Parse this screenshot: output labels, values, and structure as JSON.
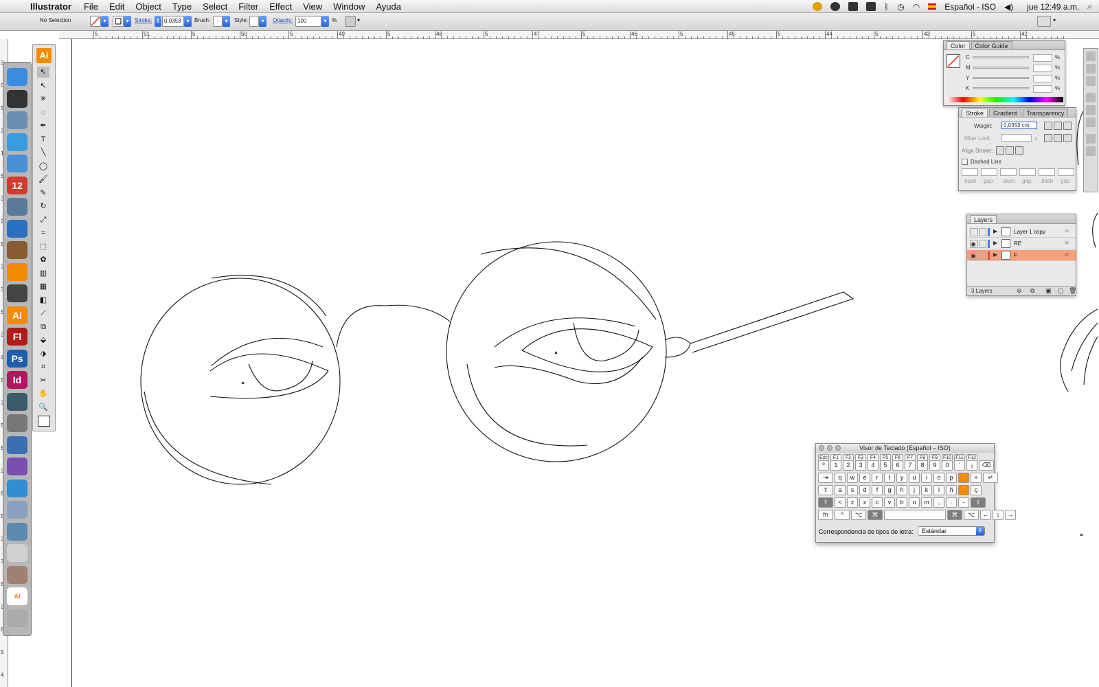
{
  "menubar": {
    "app_name": "Illustrator",
    "items": [
      "File",
      "Edit",
      "Object",
      "Type",
      "Select",
      "Filter",
      "Effect",
      "View",
      "Window",
      "Ayuda"
    ],
    "input_source": "Español - ISO",
    "clock": "jue 12:49 a.m.",
    "status_icons": [
      "moon-icon",
      "dictation-icon",
      "spaces-icon",
      "display-icon",
      "bluetooth-icon",
      "time-machine-icon",
      "wifi-icon",
      "flag-icon",
      "volume-icon",
      "spotlight-icon"
    ]
  },
  "control": {
    "selection": "No Selection",
    "stroke_label": "Stroke:",
    "stroke_value": "0,0353",
    "brush_label": "Brush:",
    "brush_value": "-",
    "style_label": "Style:",
    "opacity_label": "Opacity:",
    "opacity_value": "100",
    "percent": "%"
  },
  "ruler": {
    "h_labels": [
      "5",
      "51",
      "5",
      "50",
      "5",
      "49",
      "5",
      "48",
      "5",
      "47",
      "5",
      "46",
      "5",
      "45",
      "5",
      "44",
      "5",
      "43",
      "5",
      "42"
    ],
    "v_labels": [
      "3",
      "0",
      "5",
      "3",
      "1",
      "5",
      "3",
      "2",
      "5",
      "3",
      "3",
      "5",
      "3",
      "4",
      "5",
      "3",
      "5",
      "5",
      "3",
      "6",
      "5",
      "3",
      "7",
      "5",
      "3",
      "8",
      "5",
      "4"
    ]
  },
  "dock": {
    "items": [
      {
        "name": "finder",
        "label": "",
        "color": "#3b8be0"
      },
      {
        "name": "dashboard",
        "label": "",
        "color": "#333333"
      },
      {
        "name": "mail",
        "label": "",
        "color": "#6a8fb0"
      },
      {
        "name": "ichat",
        "label": "",
        "color": "#3b9be0"
      },
      {
        "name": "safari",
        "label": "",
        "color": "#4a90d9"
      },
      {
        "name": "ical",
        "label": "12",
        "color": "#d33a2f"
      },
      {
        "name": "iphoto",
        "label": "",
        "color": "#5a7a9a"
      },
      {
        "name": "itunes",
        "label": "",
        "color": "#2b6fc0"
      },
      {
        "name": "photo-booth",
        "label": "",
        "color": "#8a5a30"
      },
      {
        "name": "vlc",
        "label": "",
        "color": "#f28b00"
      },
      {
        "name": "imovie",
        "label": "",
        "color": "#444444"
      },
      {
        "name": "illustrator",
        "label": "Ai",
        "color": "#f28b00"
      },
      {
        "name": "flash",
        "label": "Fl",
        "color": "#b01c1c"
      },
      {
        "name": "photoshop",
        "label": "Ps",
        "color": "#1c5fb0"
      },
      {
        "name": "indesign",
        "label": "Id",
        "color": "#b0175e"
      },
      {
        "name": "time-machine",
        "label": "",
        "color": "#3b5a6a"
      },
      {
        "name": "system-preferences",
        "label": "",
        "color": "#777777"
      },
      {
        "name": "word",
        "label": "",
        "color": "#3b6fb0"
      },
      {
        "name": "entourage",
        "label": "",
        "color": "#7a4fb0"
      },
      {
        "name": "messenger",
        "label": "",
        "color": "#2f8fd0"
      },
      {
        "name": "applications-folder",
        "label": "",
        "color": "#8aa0c0"
      },
      {
        "name": "preview",
        "label": "",
        "color": "#5a8ab0"
      },
      {
        "name": "document-stack",
        "label": "",
        "color": "#d0d0d0"
      },
      {
        "name": "pictures-stack",
        "label": "",
        "color": "#a08070"
      },
      {
        "name": "ai-file",
        "label": "AI",
        "color": "#ffffff"
      },
      {
        "name": "trash",
        "label": "",
        "color": "#aaaaaa"
      }
    ]
  },
  "tools": {
    "header": "Ai",
    "items": [
      "selection",
      "direct-selection",
      "magic-wand",
      "lasso",
      "pen",
      "type",
      "line",
      "ellipse",
      "paintbrush",
      "pencil",
      "rotate",
      "scale",
      "warp",
      "free-transform",
      "symbol-sprayer",
      "column-graph",
      "mesh",
      "gradient",
      "eyedropper",
      "blend",
      "live-paint-bucket",
      "live-paint-selection",
      "crop",
      "scissors",
      "hand",
      "zoom"
    ],
    "glyphs": [
      "↖",
      "↖",
      "✳",
      "◌",
      "✒",
      "T",
      "╲",
      "◯",
      "🖌",
      "✎",
      "↻",
      "⤢",
      "≈",
      "⬚",
      "✿",
      "▥",
      "▦",
      "◧",
      "⟋",
      "⧉",
      "⬙",
      "⬗",
      "⌗",
      "✂",
      "✋",
      "🔍"
    ]
  },
  "color_panel": {
    "tabs": [
      "Color",
      "Color Guide"
    ],
    "channels": [
      "C",
      "M",
      "Y",
      "K"
    ],
    "percent": "%"
  },
  "stroke_panel": {
    "tabs": [
      "Stroke",
      "Gradient",
      "Transparency"
    ],
    "weight_label": "Weight:",
    "weight_value": "0,0353 cm",
    "miter_label": "Miter Limit:",
    "miter_x": "x",
    "align_label": "Align Stroke:",
    "dashed_label": "Dashed Line",
    "dash_labels": [
      "dash",
      "gap",
      "dash",
      "gap",
      "dash",
      "gap"
    ]
  },
  "layers_panel": {
    "tab": "Layers",
    "layers": [
      {
        "name": "Layer 1 copy",
        "color": "#4a7ae0",
        "visible": false,
        "selected": false
      },
      {
        "name": "RE",
        "color": "#4a7ae0",
        "visible": true,
        "selected": false
      },
      {
        "name": "F",
        "color": "#e04a4a",
        "visible": true,
        "selected": true
      }
    ],
    "count": "3 Layers",
    "selected_color": "#f7a07a"
  },
  "keyboard_viewer": {
    "title": "Visor de Teclado (Español – ISO)",
    "fn_row": [
      "Esc",
      "F1",
      "F2",
      "F3",
      "F4",
      "F5",
      "F6",
      "F7",
      "F8",
      "F9",
      "F10",
      "F11",
      "F12"
    ],
    "row1": [
      "º",
      "1",
      "2",
      "3",
      "4",
      "5",
      "6",
      "7",
      "8",
      "9",
      "0",
      "'",
      "¡",
      "⌫"
    ],
    "row2": [
      "⇥",
      "q",
      "w",
      "e",
      "r",
      "t",
      "y",
      "u",
      "i",
      "o",
      "p",
      "`",
      "+",
      "↵"
    ],
    "row3": [
      "⇪",
      "a",
      "s",
      "d",
      "f",
      "g",
      "h",
      "j",
      "k",
      "l",
      "ñ",
      "´",
      "ç"
    ],
    "row4": [
      "⇧",
      "<",
      "z",
      "x",
      "c",
      "v",
      "b",
      "n",
      "m",
      ",",
      ".",
      "-",
      "⇧"
    ],
    "row5": [
      "fn",
      "^",
      "⌥",
      "⌘",
      "",
      "⌘",
      "⌥",
      "←",
      "↕",
      "→"
    ],
    "mapping_label": "Correspondencia de tipos de letra:",
    "mapping_value": "Estándar"
  },
  "colors": {
    "accent_orange": "#f28b00",
    "link_blue": "#1c45b0"
  }
}
